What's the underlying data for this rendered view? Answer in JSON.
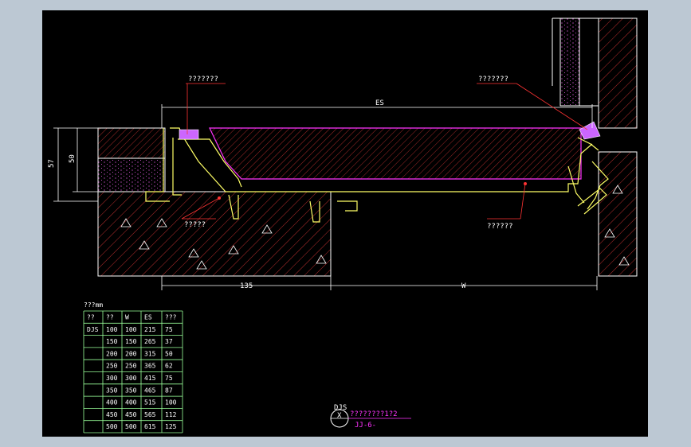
{
  "callouts": {
    "top_left": "???????",
    "top_right": "???????",
    "bottom_left": "?????",
    "bottom_right": "??????"
  },
  "dimensions": {
    "es": "ES",
    "h57": "57",
    "h50": "50",
    "w135": "135",
    "w": "W"
  },
  "table": {
    "caption": "???mm",
    "headers": [
      "??",
      "??",
      "W",
      "ES",
      "???"
    ],
    "rows": [
      [
        "DJS",
        "100",
        "100",
        "215",
        "75"
      ],
      [
        "",
        "150",
        "150",
        "265",
        "37"
      ],
      [
        "",
        "200",
        "200",
        "315",
        "50"
      ],
      [
        "",
        "250",
        "250",
        "365",
        "62"
      ],
      [
        "",
        "300",
        "300",
        "415",
        "75"
      ],
      [
        "",
        "350",
        "350",
        "465",
        "87"
      ],
      [
        "",
        "400",
        "400",
        "515",
        "100"
      ],
      [
        "",
        "450",
        "450",
        "565",
        "112"
      ],
      [
        "",
        "500",
        "500",
        "615",
        "125"
      ]
    ]
  },
  "title_block": {
    "code": "DJS",
    "title": "????????1?2",
    "sheet": "JJ-6-"
  },
  "colors": {
    "background": "#000000",
    "frame": "#bcc8d3",
    "lines": "#ffffff",
    "hatch": "#cc3333",
    "profile": "#ffff66",
    "seal": "#cc66ff",
    "accent": "#ff33ff",
    "table": "#99ff99"
  }
}
